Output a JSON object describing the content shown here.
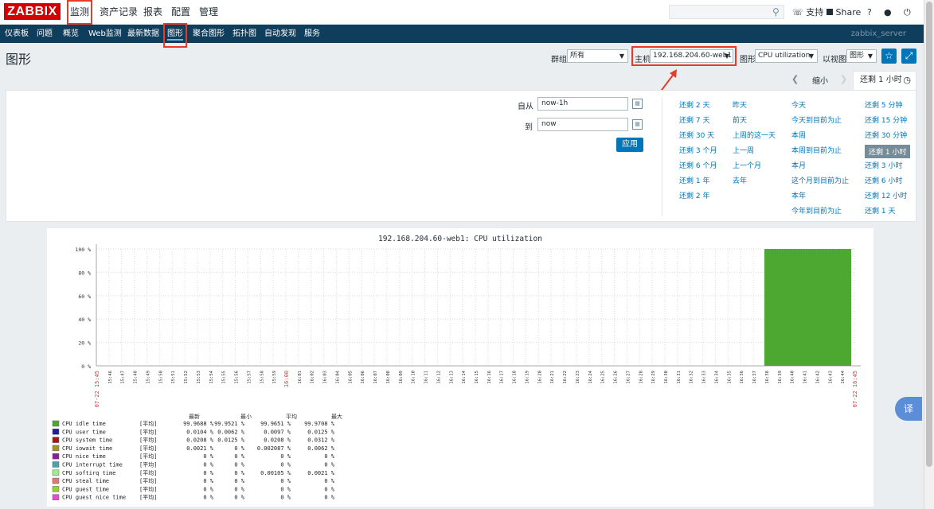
{
  "brand": {
    "logo": "ZABBIX"
  },
  "topmenu": [
    "监测",
    "资产记录",
    "报表",
    "配置",
    "管理"
  ],
  "topright": {
    "support": "支持",
    "share": "Share",
    "help": "?"
  },
  "nav": {
    "items": [
      "仪表板",
      "问题",
      "概览",
      "Web监测",
      "最新数据",
      "图形",
      "聚合图形",
      "拓扑图",
      "自动发现",
      "服务"
    ],
    "server": "zabbix_server"
  },
  "page": {
    "title": "图形"
  },
  "filter": {
    "group_label": "群组",
    "group_value": "所有",
    "host_label": "主机",
    "host_value": "192.168.204.60-web1",
    "graph_label": "图形",
    "graph_value": "CPU utilization",
    "view_label": "以视图",
    "view_value": "图形"
  },
  "timetabs": {
    "zoom_out": "缩小",
    "active": "还剩 1 小时"
  },
  "timepanel": {
    "from_label": "自从",
    "from_value": "now-1h",
    "to_label": "到",
    "to_value": "now",
    "apply": "应用",
    "quick": [
      [
        "还剩 2 天",
        "还剩 7 天",
        "还剩 30 天",
        "还剩 3 个月",
        "还剩 6 个月",
        "还剩 1 年",
        "还剩 2 年"
      ],
      [
        "昨天",
        "前天",
        "上周的这一天",
        "上一周",
        "上一个月",
        "去年"
      ],
      [
        "今天",
        "今天到目前为止",
        "本周",
        "本周到目前为止",
        "本月",
        "这个月到目前为止",
        "本年",
        "今年到目前为止"
      ],
      [
        "还剩 5 分钟",
        "还剩 15 分钟",
        "还剩 30 分钟",
        "还剩 1 小时",
        "还剩 3 小时",
        "还剩 6 小时",
        "还剩 12 小时",
        "还剩 1 天"
      ]
    ],
    "selected": "还剩 1 小时"
  },
  "colors": {
    "accent": "#0275b8",
    "nav_bg": "#0f3d5c",
    "highlight": "#e53b2b",
    "idle": "#4da832"
  },
  "chart_data": {
    "type": "area",
    "title": "192.168.204.60-web1: CPU utilization",
    "ylim": [
      0,
      100
    ],
    "y_ticks": [
      "0 %",
      "20 %",
      "40 %",
      "60 %",
      "80 %",
      "100 %"
    ],
    "x_ticks": [
      "07-22 15:45",
      "15:46",
      "15:47",
      "15:48",
      "15:49",
      "15:50",
      "15:51",
      "15:52",
      "15:53",
      "15:54",
      "15:55",
      "15:56",
      "15:57",
      "15:58",
      "15:59",
      "16:00",
      "16:01",
      "16:02",
      "16:03",
      "16:04",
      "16:05",
      "16:06",
      "16:07",
      "16:08",
      "16:09",
      "16:10",
      "16:11",
      "16:12",
      "16:13",
      "16:14",
      "16:15",
      "16:16",
      "16:17",
      "16:18",
      "16:19",
      "16:20",
      "16:21",
      "16:22",
      "16:23",
      "16:24",
      "16:25",
      "16:26",
      "16:27",
      "16:28",
      "16:29",
      "16:30",
      "16:31",
      "16:32",
      "16:33",
      "16:34",
      "16:35",
      "16:36",
      "16:37",
      "16:38",
      "16:39",
      "16:40",
      "16:41",
      "16:42",
      "16:43",
      "16:44",
      "07-22 16:45"
    ],
    "data_range": {
      "start": "16:38",
      "end": "16:45"
    },
    "series": [
      {
        "name": "CPU idle time",
        "values": [
          99.97
        ]
      }
    ],
    "legend_headers": [
      "最新",
      "最小",
      "平均",
      "最大"
    ],
    "legend": [
      {
        "name": "CPU idle time",
        "color": "#4da832",
        "agg": "[平均]",
        "last": "99.9688 %",
        "min": "99.9521 %",
        "avg": "99.9651 %",
        "max": "99.9708 %"
      },
      {
        "name": "CPU user time",
        "color": "#1f1f9c",
        "agg": "[平均]",
        "last": "0.0104 %",
        "min": "0.0062 %",
        "avg": "0.0097 %",
        "max": "0.0125 %"
      },
      {
        "name": "CPU system time",
        "color": "#9e1a1a",
        "agg": "[平均]",
        "last": "0.0208 %",
        "min": "0.0125 %",
        "avg": "0.0208 %",
        "max": "0.0312 %"
      },
      {
        "name": "CPU iowait time",
        "color": "#a39322",
        "agg": "[平均]",
        "last": "0.0021 %",
        "min": "0 %",
        "avg": "0.002087 %",
        "max": "0.0062 %"
      },
      {
        "name": "CPU nice time",
        "color": "#8b1c9b",
        "agg": "[平均]",
        "last": "0 %",
        "min": "0 %",
        "avg": "0 %",
        "max": "0 %"
      },
      {
        "name": "CPU interrupt time",
        "color": "#4aa3a8",
        "agg": "[平均]",
        "last": "0 %",
        "min": "0 %",
        "avg": "0 %",
        "max": "0 %"
      },
      {
        "name": "CPU softirq time",
        "color": "#9aef8f",
        "agg": "[平均]",
        "last": "0 %",
        "min": "0 %",
        "avg": "0.00105 %",
        "max": "0.0021 %"
      },
      {
        "name": "CPU steal time",
        "color": "#e0787a",
        "agg": "[平均]",
        "last": "0 %",
        "min": "0 %",
        "avg": "0 %",
        "max": "0 %"
      },
      {
        "name": "CPU guest time",
        "color": "#9cce34",
        "agg": "[平均]",
        "last": "0 %",
        "min": "0 %",
        "avg": "0 %",
        "max": "0 %"
      },
      {
        "name": "CPU guest nice time",
        "color": "#e34bd6",
        "agg": "[平均]",
        "last": "0 %",
        "min": "0 %",
        "avg": "0 %",
        "max": "0 %"
      }
    ]
  },
  "misc": {
    "translate": "译"
  }
}
